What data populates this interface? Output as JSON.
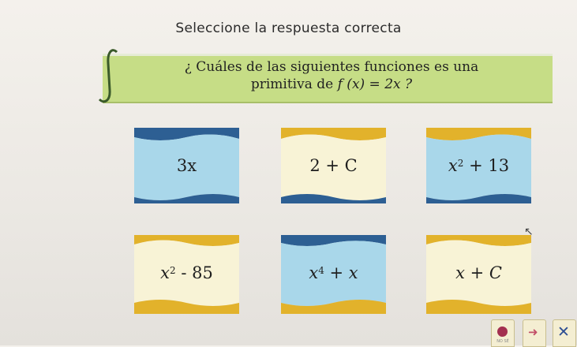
{
  "top_strip": "",
  "heading": "Seleccione la respuesta correcta",
  "question": {
    "line1": "¿ Cuáles de las siguientes funciones es una",
    "line2_prefix": "primitiva de ",
    "line2_fx": "f (x) = 2x ?"
  },
  "options": [
    {
      "text": "3x",
      "color": "#a9d7ea"
    },
    {
      "text": "2 + C",
      "color": "#f8f3d6"
    },
    {
      "text_base": "x",
      "text_exp": "2",
      "text_rest": " + 13",
      "color": "#a9d7ea"
    },
    {
      "text_base": "x",
      "text_exp": "2",
      "text_rest": " - 85",
      "color": "#f8f3d6"
    },
    {
      "text_base": "x",
      "text_exp": "4",
      "text_rest": " + x",
      "color": "#a9d7ea"
    },
    {
      "text": "x + C",
      "color": "#f8f3d6"
    }
  ],
  "buttons": {
    "help_label": "NO SÉ",
    "next_icon": "arrow-right-icon",
    "close_icon": "close-icon"
  },
  "colors": {
    "question_bg": "#c6dd86",
    "yellow_band": "#e2b22b",
    "blue_band": "#2d5f93",
    "light_blue": "#a9d7ea",
    "cream": "#f8f3d6"
  }
}
